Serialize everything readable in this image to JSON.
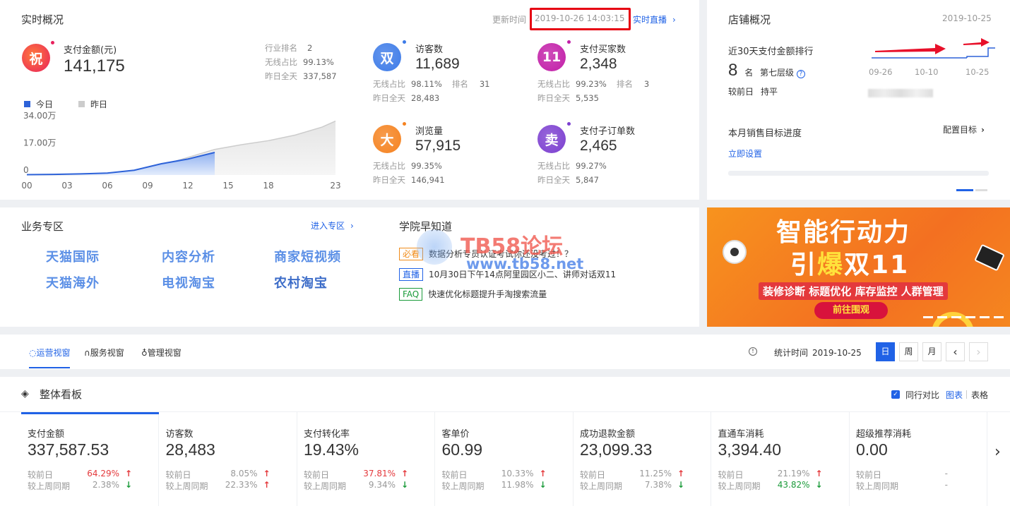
{
  "realtime": {
    "title": "实时概况",
    "update_label": "更新时间",
    "update_time": "2019-10-26 14:03:15",
    "live_link": "实时直播",
    "pay": {
      "badge": "祝",
      "label": "支付金额(元)",
      "value": "141,175",
      "rank_label": "行业排名",
      "rank_value": "2",
      "wireless_label": "无线占比",
      "wireless_value": "99.13%",
      "yesterday_label": "昨日全天",
      "yesterday_value": "337,587"
    },
    "legend_today": "今日",
    "legend_yesterday": "昨日",
    "metrics": [
      {
        "badge": "双",
        "label": "访客数",
        "value": "11,689",
        "wireless_label": "无线占比",
        "wireless_value": "98.11%",
        "rank_label": "排名",
        "rank_value": "31",
        "yesterday_label": "昨日全天",
        "yesterday_value": "28,483",
        "color": "#3d7be8"
      },
      {
        "badge": "11",
        "label": "支付买家数",
        "value": "2,348",
        "wireless_label": "无线占比",
        "wireless_value": "99.23%",
        "rank_label": "排名",
        "rank_value": "3",
        "yesterday_label": "昨日全天",
        "yesterday_value": "5,535",
        "color": "#c21fa8"
      },
      {
        "badge": "大",
        "label": "浏览量",
        "value": "57,915",
        "wireless_label": "无线占比",
        "wireless_value": "99.35%",
        "yesterday_label": "昨日全天",
        "yesterday_value": "146,941",
        "color": "#f5821f"
      },
      {
        "badge": "卖",
        "label": "支付子订单数",
        "value": "2,465",
        "wireless_label": "无线占比",
        "wireless_value": "99.27%",
        "yesterday_label": "昨日全天",
        "yesterday_value": "5,847",
        "color": "#7c3fd0"
      }
    ]
  },
  "chart_data": {
    "type": "area",
    "x": [
      0,
      3,
      6,
      9,
      12,
      15,
      18,
      23
    ],
    "xticks": [
      "00",
      "03",
      "06",
      "09",
      "12",
      "15",
      "18",
      "23"
    ],
    "yticks": [
      "34.00万",
      "17.00万",
      "0"
    ],
    "ylim": [
      0,
      340000
    ],
    "series": [
      {
        "name": "今日",
        "x": [
          0,
          2,
          4,
          6,
          8,
          10,
          12,
          14
        ],
        "values": [
          2000,
          4000,
          7000,
          12000,
          30000,
          70000,
          100000,
          141175
        ],
        "color": "#2d62d8"
      },
      {
        "name": "昨日",
        "x": [
          0,
          2,
          4,
          6,
          8,
          9,
          10,
          12,
          14,
          16,
          18,
          20,
          22,
          23
        ],
        "values": [
          1000,
          1500,
          2000,
          3000,
          4000,
          8000,
          60000,
          110000,
          160000,
          190000,
          215000,
          250000,
          300000,
          337587
        ],
        "color": "#cccccc"
      }
    ],
    "grid": false,
    "legend": "top-left"
  },
  "shop": {
    "title": "店铺概况",
    "date": "2019-10-25",
    "rank_label": "近30天支付金额排行",
    "rank_value": "8",
    "rank_unit": "名",
    "level": "第七层级",
    "compare_label": "较前日",
    "compare_value": "持平",
    "mini_ticks": [
      "09-26",
      "10-10",
      "10-25"
    ],
    "target_label": "本月销售目标进度",
    "config_link": "配置目标",
    "set_link": "立即设置"
  },
  "business": {
    "title": "业务专区",
    "enter_link": "进入专区",
    "links": [
      "天猫国际",
      "内容分析",
      "商家短视频",
      "天猫海外",
      "电视淘宝",
      "农村淘宝"
    ]
  },
  "academy": {
    "title": "学院早知道",
    "items": [
      {
        "tag": "必看",
        "text": "数据分析专员认证考试你还没考过！？",
        "color": "#f08c1a"
      },
      {
        "tag": "直播",
        "text": "10月30日下午14点阿里园区小二、讲师对话双11",
        "color": "#2062e6"
      },
      {
        "tag": "FAQ",
        "text": "快速优化标题提升手淘搜索流量",
        "color": "#1b9b3a"
      }
    ]
  },
  "watermark": {
    "line1": "TB58论坛",
    "line2": "www.tb58.net"
  },
  "banner": {
    "line1": "智能行动力",
    "line2a": "引",
    "line2b": "爆",
    "line2c": "双11",
    "features": "装修诊断 标题优化 库存监控 人群管理",
    "button": "前往围观"
  },
  "tabs": {
    "items": [
      "运营视窗",
      "服务视窗",
      "管理视窗"
    ],
    "stat_label": "统计时间",
    "stat_date": "2019-10-25",
    "day": "日",
    "week": "周",
    "month": "月"
  },
  "board": {
    "title": "整体看板",
    "peer_label": "同行对比",
    "chart_link": "图表",
    "table_link": "表格",
    "kpis": [
      {
        "label": "支付金额",
        "value": "337,587.53",
        "d1_label": "较前日",
        "d1": "64.29%",
        "d1_dir": "up",
        "d1_hl": "red",
        "w_label": "较上周同期",
        "w": "2.38%",
        "w_dir": "down",
        "w_hl": ""
      },
      {
        "label": "访客数",
        "value": "28,483",
        "d1_label": "较前日",
        "d1": "8.05%",
        "d1_dir": "up",
        "d1_hl": "",
        "w_label": "较上周同期",
        "w": "22.33%",
        "w_dir": "up",
        "w_hl": ""
      },
      {
        "label": "支付转化率",
        "value": "19.43%",
        "d1_label": "较前日",
        "d1": "37.81%",
        "d1_dir": "up",
        "d1_hl": "red",
        "w_label": "较上周同期",
        "w": "9.34%",
        "w_dir": "down",
        "w_hl": ""
      },
      {
        "label": "客单价",
        "value": "60.99",
        "d1_label": "较前日",
        "d1": "10.33%",
        "d1_dir": "up",
        "d1_hl": "",
        "w_label": "较上周同期",
        "w": "11.98%",
        "w_dir": "down",
        "w_hl": ""
      },
      {
        "label": "成功退款金额",
        "value": "23,099.33",
        "d1_label": "较前日",
        "d1": "11.25%",
        "d1_dir": "up",
        "d1_hl": "",
        "w_label": "较上周同期",
        "w": "7.38%",
        "w_dir": "down",
        "w_hl": ""
      },
      {
        "label": "直通车消耗",
        "value": "3,394.40",
        "d1_label": "较前日",
        "d1": "21.19%",
        "d1_dir": "up",
        "d1_hl": "",
        "w_label": "较上周同期",
        "w": "43.82%",
        "w_dir": "down",
        "w_hl": "green"
      },
      {
        "label": "超级推荐消耗",
        "value": "0.00",
        "d1_label": "较前日",
        "d1": "-",
        "d1_dir": "",
        "d1_hl": "",
        "w_label": "较上周同期",
        "w": "-",
        "w_dir": "",
        "w_hl": ""
      }
    ]
  }
}
